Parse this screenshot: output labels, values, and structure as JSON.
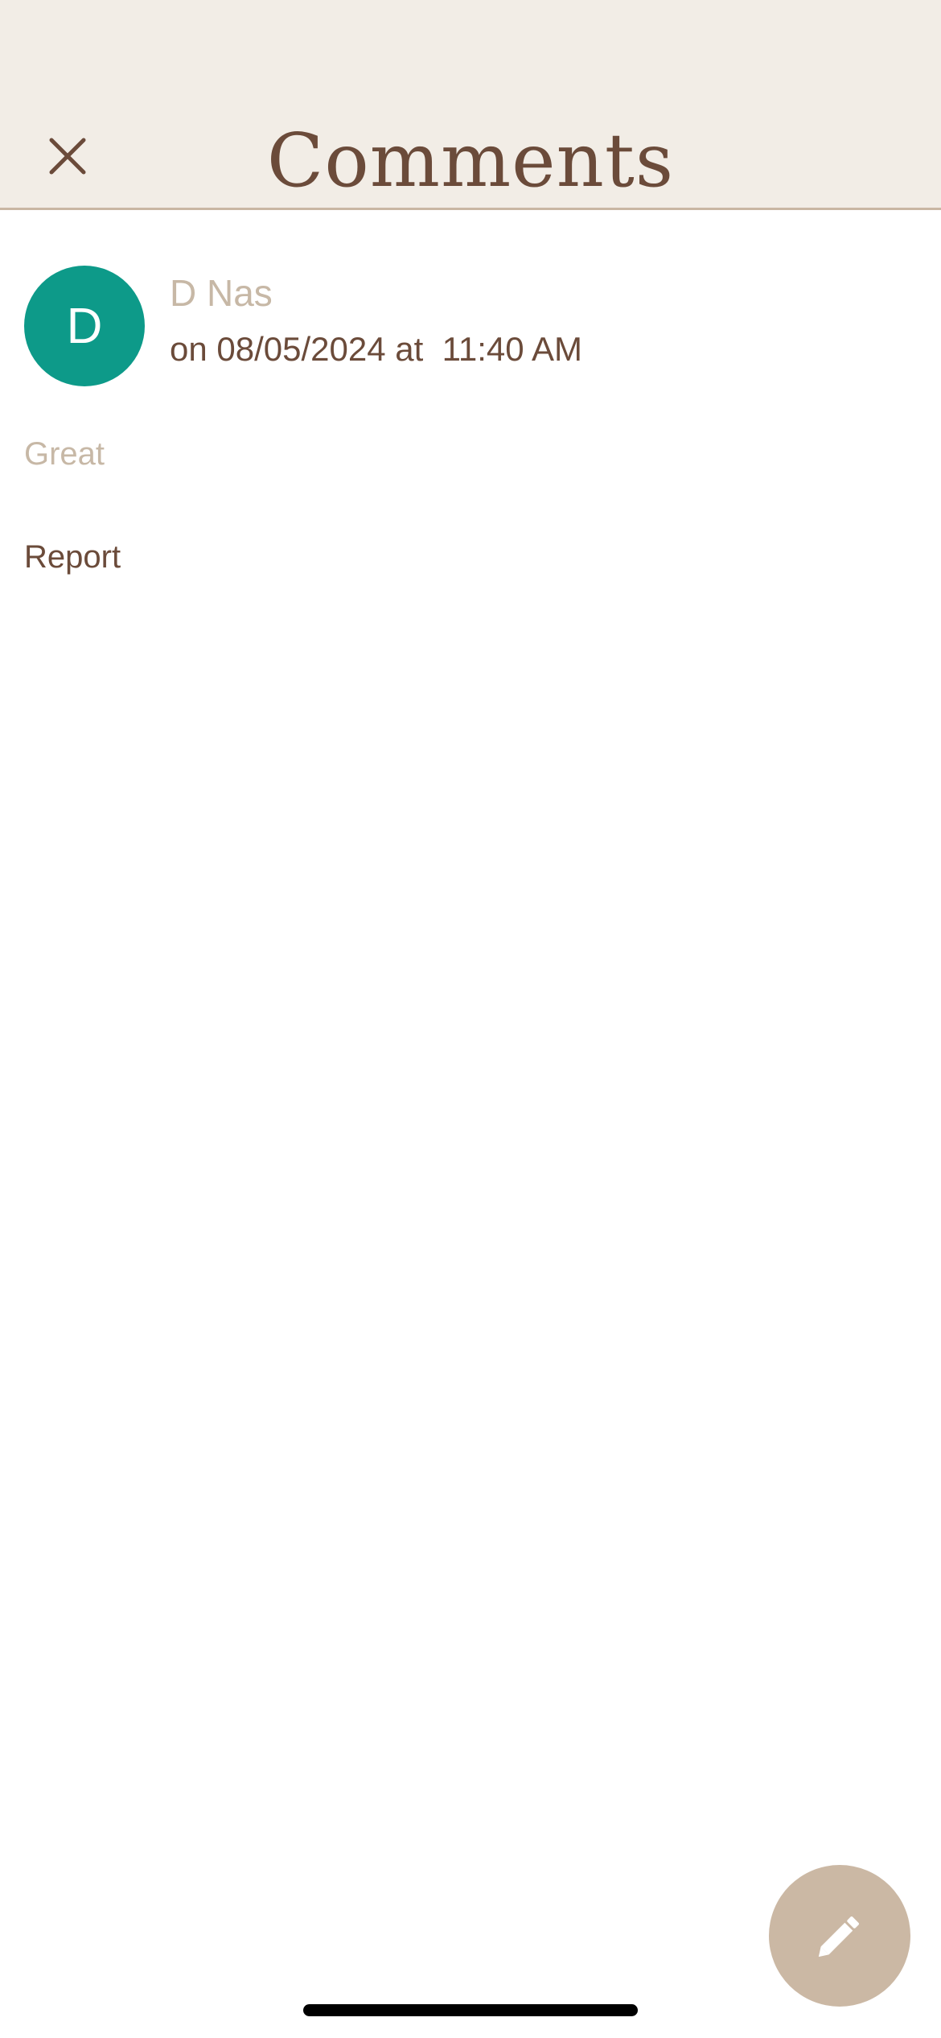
{
  "header": {
    "title": "Comments",
    "close_icon": "close-icon",
    "background": "#f2ede6",
    "divider_color": "#c9b6a3",
    "text_color": "#6b4b3a"
  },
  "comment": {
    "avatar_initial": "D",
    "avatar_color": "#0d9a89",
    "author": "D Nas",
    "meta": "on 08/05/2024 at  11:40 AM",
    "text": "Great",
    "report_label": "Report"
  },
  "fab": {
    "icon": "pencil-icon",
    "color": "#cbb8a4"
  }
}
